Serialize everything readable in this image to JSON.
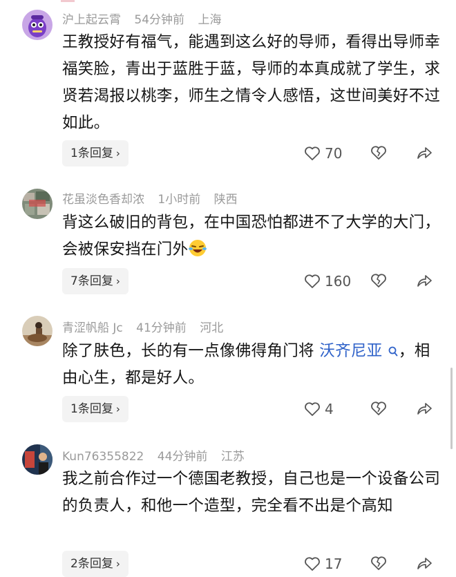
{
  "comments": [
    {
      "user": "沪上起云霄",
      "time": "54分钟前",
      "location": "上海",
      "text": "王教授好有福气，能遇到这么好的导师，看得出导师幸福笑脸，青出于蓝胜于蓝，导师的本真成就了学生，求贤若渴报以桃李，师生之情令人感悟，这世间美好不过如此。",
      "replies": "1条回复",
      "likes": "70"
    },
    {
      "user": "花虽淡色香却浓",
      "time": "1小时前",
      "location": "陕西",
      "text": "背这么破旧的背包，在中国恐怕都进不了大学的大门，会被保安挡在门外",
      "emoji_icon": "laughing-crying-emoji-icon",
      "replies": "7条回复",
      "likes": "160"
    },
    {
      "user": "青涩帆船 Jc",
      "time": "41分钟前",
      "location": "河北",
      "text_before": "除了肤色，长的有一点像佛得角门将 ",
      "mention": "沃齐尼亚",
      "text_after": "，相由心生，都是好人。",
      "replies": "1条回复",
      "likes": "4"
    },
    {
      "user": "Kun76355822",
      "time": "44分钟前",
      "location": "江苏",
      "text": "我之前合作过一个德国老教授，自己也是一个设备公司的负责人，和他一个造型，完全看不出是个高知",
      "replies": "2条回复",
      "likes": "17"
    }
  ],
  "icons": {
    "like": "heart-outline-icon",
    "dislike": "broken-heart-icon",
    "share": "share-arrow-icon",
    "chevron": "chevron-right-icon",
    "search": "search-icon"
  },
  "colors": {
    "meta_gray": "#9a9a9a",
    "mention_blue": "#2f62c9",
    "reply_bg": "#f3f3f3"
  }
}
